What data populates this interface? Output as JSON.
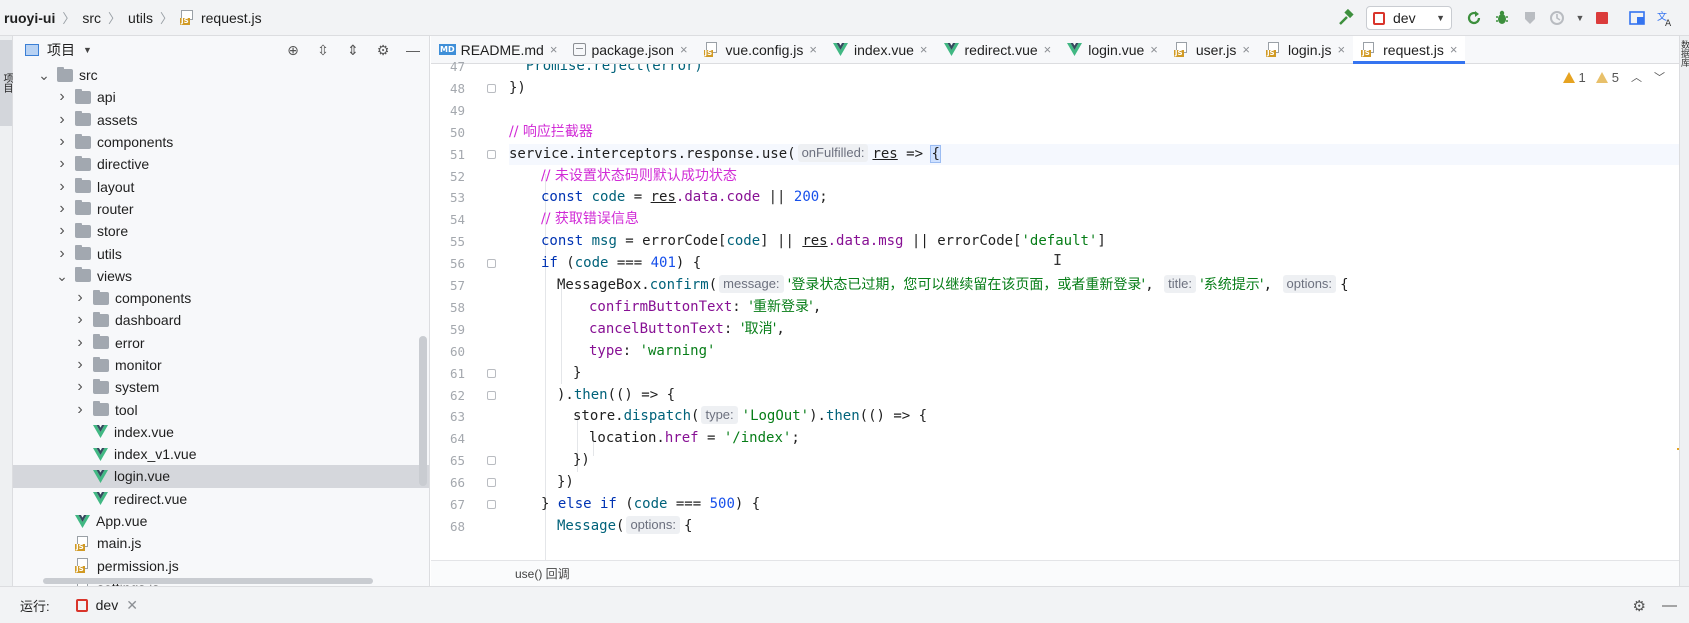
{
  "breadcrumb": {
    "project": "ruoyi-ui",
    "src": "src",
    "utils": "utils",
    "file": "request.js"
  },
  "toolbar": {
    "run_config": "dev",
    "icons": [
      "hammer-icon",
      "rerun-icon",
      "debug-icon",
      "coverage-icon",
      "profile-icon",
      "stop-icon",
      "project-structure-icon",
      "translate-icon"
    ]
  },
  "left_stripe": {
    "tab_label": "项目"
  },
  "project_panel": {
    "title": "项目",
    "tree": [
      {
        "label": "src",
        "type": "folder",
        "level": 0,
        "expanded": true
      },
      {
        "label": "api",
        "type": "folder",
        "level": 1,
        "expanded": false
      },
      {
        "label": "assets",
        "type": "folder",
        "level": 1,
        "expanded": false
      },
      {
        "label": "components",
        "type": "folder",
        "level": 1,
        "expanded": false
      },
      {
        "label": "directive",
        "type": "folder",
        "level": 1,
        "expanded": false
      },
      {
        "label": "layout",
        "type": "folder",
        "level": 1,
        "expanded": false
      },
      {
        "label": "router",
        "type": "folder",
        "level": 1,
        "expanded": false
      },
      {
        "label": "store",
        "type": "folder",
        "level": 1,
        "expanded": false
      },
      {
        "label": "utils",
        "type": "folder",
        "level": 1,
        "expanded": false
      },
      {
        "label": "views",
        "type": "folder",
        "level": 1,
        "expanded": true
      },
      {
        "label": "components",
        "type": "folder",
        "level": 2,
        "expanded": false
      },
      {
        "label": "dashboard",
        "type": "folder",
        "level": 2,
        "expanded": false
      },
      {
        "label": "error",
        "type": "folder",
        "level": 2,
        "expanded": false
      },
      {
        "label": "monitor",
        "type": "folder",
        "level": 2,
        "expanded": false
      },
      {
        "label": "system",
        "type": "folder",
        "level": 2,
        "expanded": false
      },
      {
        "label": "tool",
        "type": "folder",
        "level": 2,
        "expanded": false
      },
      {
        "label": "index.vue",
        "type": "vue",
        "level": 2
      },
      {
        "label": "index_v1.vue",
        "type": "vue",
        "level": 2
      },
      {
        "label": "login.vue",
        "type": "vue",
        "level": 2,
        "selected": true
      },
      {
        "label": "redirect.vue",
        "type": "vue",
        "level": 2
      },
      {
        "label": "App.vue",
        "type": "vue",
        "level": 1
      },
      {
        "label": "main.js",
        "type": "js",
        "level": 1
      },
      {
        "label": "permission.js",
        "type": "js",
        "level": 1
      },
      {
        "label": "settings.js",
        "type": "js",
        "level": 1
      }
    ]
  },
  "tabs": [
    {
      "label": "README.md",
      "icon": "markdown-icon"
    },
    {
      "label": "package.json",
      "icon": "package-icon"
    },
    {
      "label": "vue.config.js",
      "icon": "js-file-icon"
    },
    {
      "label": "index.vue",
      "icon": "vue-icon"
    },
    {
      "label": "redirect.vue",
      "icon": "vue-icon"
    },
    {
      "label": "login.vue",
      "icon": "vue-icon"
    },
    {
      "label": "user.js",
      "icon": "js-file-icon"
    },
    {
      "label": "login.js",
      "icon": "js-file-icon"
    },
    {
      "label": "request.js",
      "icon": "js-file-icon",
      "active": true
    }
  ],
  "inspections": {
    "warnings": "1",
    "weak_warnings": "5"
  },
  "code": {
    "line_numbers": [
      "47",
      "48",
      "49",
      "50",
      "51",
      "52",
      "53",
      "54",
      "55",
      "56",
      "57",
      "58",
      "59",
      "60",
      "61",
      "62",
      "63",
      "64",
      "65",
      "66",
      "67",
      "68"
    ],
    "l47": "  Promise.reject(error)",
    "l48": "})",
    "l50_comment": "// 响应拦截器",
    "l51_a": "service.interceptors.response.use(",
    "l51_hint": "onFulfilled:",
    "l51_res": "res",
    "l51_b": " => ",
    "l51_brace": "{",
    "l52_comment": "// 未设置状态码则默认成功状态",
    "l53_kw": "const",
    "l53_var": " code",
    "l53_eq": " = ",
    "l53_res": "res",
    "l53_prop": ".data.code",
    "l53_or": " || ",
    "l53_num": "200",
    "l53_end": ";",
    "l54_comment": "// 获取错误信息",
    "l55_kw": "const",
    "l55_var": " msg",
    "l55_mid": " = errorCode[",
    "l55_code": "code",
    "l55_mid2": "] || ",
    "l55_res": "res",
    "l55_prop": ".data.msg",
    "l55_mid3": " || errorCode[",
    "l55_str": "'default'",
    "l55_end": "]",
    "l56_kw": "if",
    "l56_a": " (",
    "l56_code": "code",
    "l56_b": " === ",
    "l56_num": "401",
    "l56_c": ") {",
    "l57_a": "MessageBox.",
    "l57_fn": "confirm",
    "l57_b": "(",
    "l57_hint1": "message:",
    "l57_str1": "'登录状态已过期，您可以继续留在该页面，或者重新登录'",
    "l57_c": ", ",
    "l57_hint2": "title:",
    "l57_str2": "'系统提示'",
    "l57_d": ", ",
    "l57_hint3": "options:",
    "l57_e": "{",
    "l58_prop": "confirmButtonText",
    "l58_a": ": ",
    "l58_str": "'重新登录'",
    "l58_b": ",",
    "l59_prop": "cancelButtonText",
    "l59_a": ": ",
    "l59_str": "'取消'",
    "l59_b": ",",
    "l60_prop": "type",
    "l60_a": ": ",
    "l60_str": "'warning'",
    "l61": "}",
    "l62_a": ").",
    "l62_fn": "then",
    "l62_b": "(() => {",
    "l63_a": "store.",
    "l63_fn": "dispatch",
    "l63_b": "(",
    "l63_hint": "type:",
    "l63_str": "'LogOut'",
    "l63_c": ").",
    "l63_fn2": "then",
    "l63_d": "(() => {",
    "l64_a": "location.",
    "l64_prop": "href",
    "l64_b": " = ",
    "l64_str": "'/index'",
    "l64_c": ";",
    "l65": "})",
    "l66": "})",
    "l67_a": "} ",
    "l67_kw": "else if",
    "l67_b": " (",
    "l67_code": "code",
    "l67_c": " === ",
    "l67_num": "500",
    "l67_d": ") {",
    "l68_fn": "Message",
    "l68_a": "(",
    "l68_hint": "options:",
    "l68_b": "{"
  },
  "editor_breadcrumb": "use() 回调",
  "bottom": {
    "label": "运行:",
    "run_tab": "dev"
  },
  "right_stripe": {
    "tab_label": "数据库"
  }
}
